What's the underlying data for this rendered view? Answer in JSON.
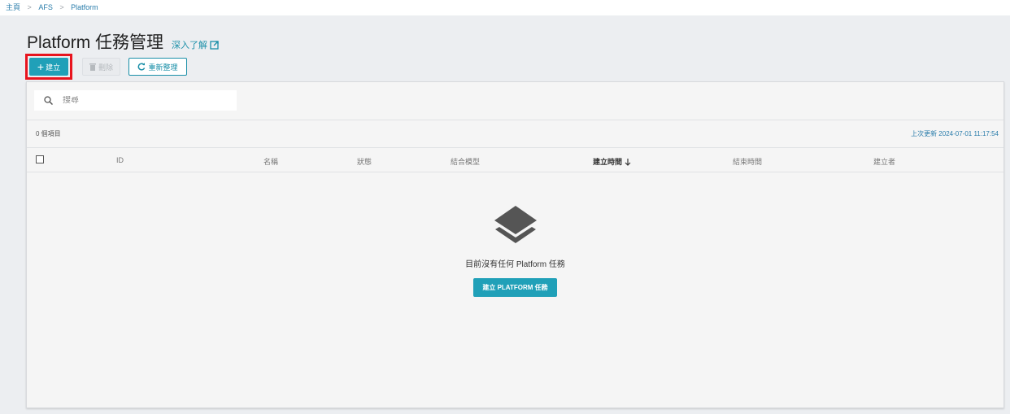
{
  "breadcrumb": {
    "items": [
      "主頁",
      "AFS",
      "Platform"
    ],
    "separator": ">"
  },
  "header": {
    "title": "Platform 任務管理",
    "learn_more": "深入了解"
  },
  "toolbar": {
    "create_label": "建立",
    "delete_label": "刪除",
    "manage_label": "重新整理"
  },
  "search": {
    "placeholder": "搜尋"
  },
  "summary": {
    "count": "0 個項目",
    "last_updated": "上次更新 2024-07-01 11:17:54"
  },
  "table": {
    "columns": [
      "ID",
      "名稱",
      "狀態",
      "結合模型",
      "建立時間",
      "結束時間",
      "建立者"
    ],
    "sorted_column": "建立時間",
    "rows": []
  },
  "empty_state": {
    "message": "目前沒有任何 Platform 任務",
    "button_label": "建立 PLATFORM 任務"
  },
  "colors": {
    "accent": "#20a0b8",
    "highlight": "#e8141e",
    "link": "#2a7dab"
  }
}
